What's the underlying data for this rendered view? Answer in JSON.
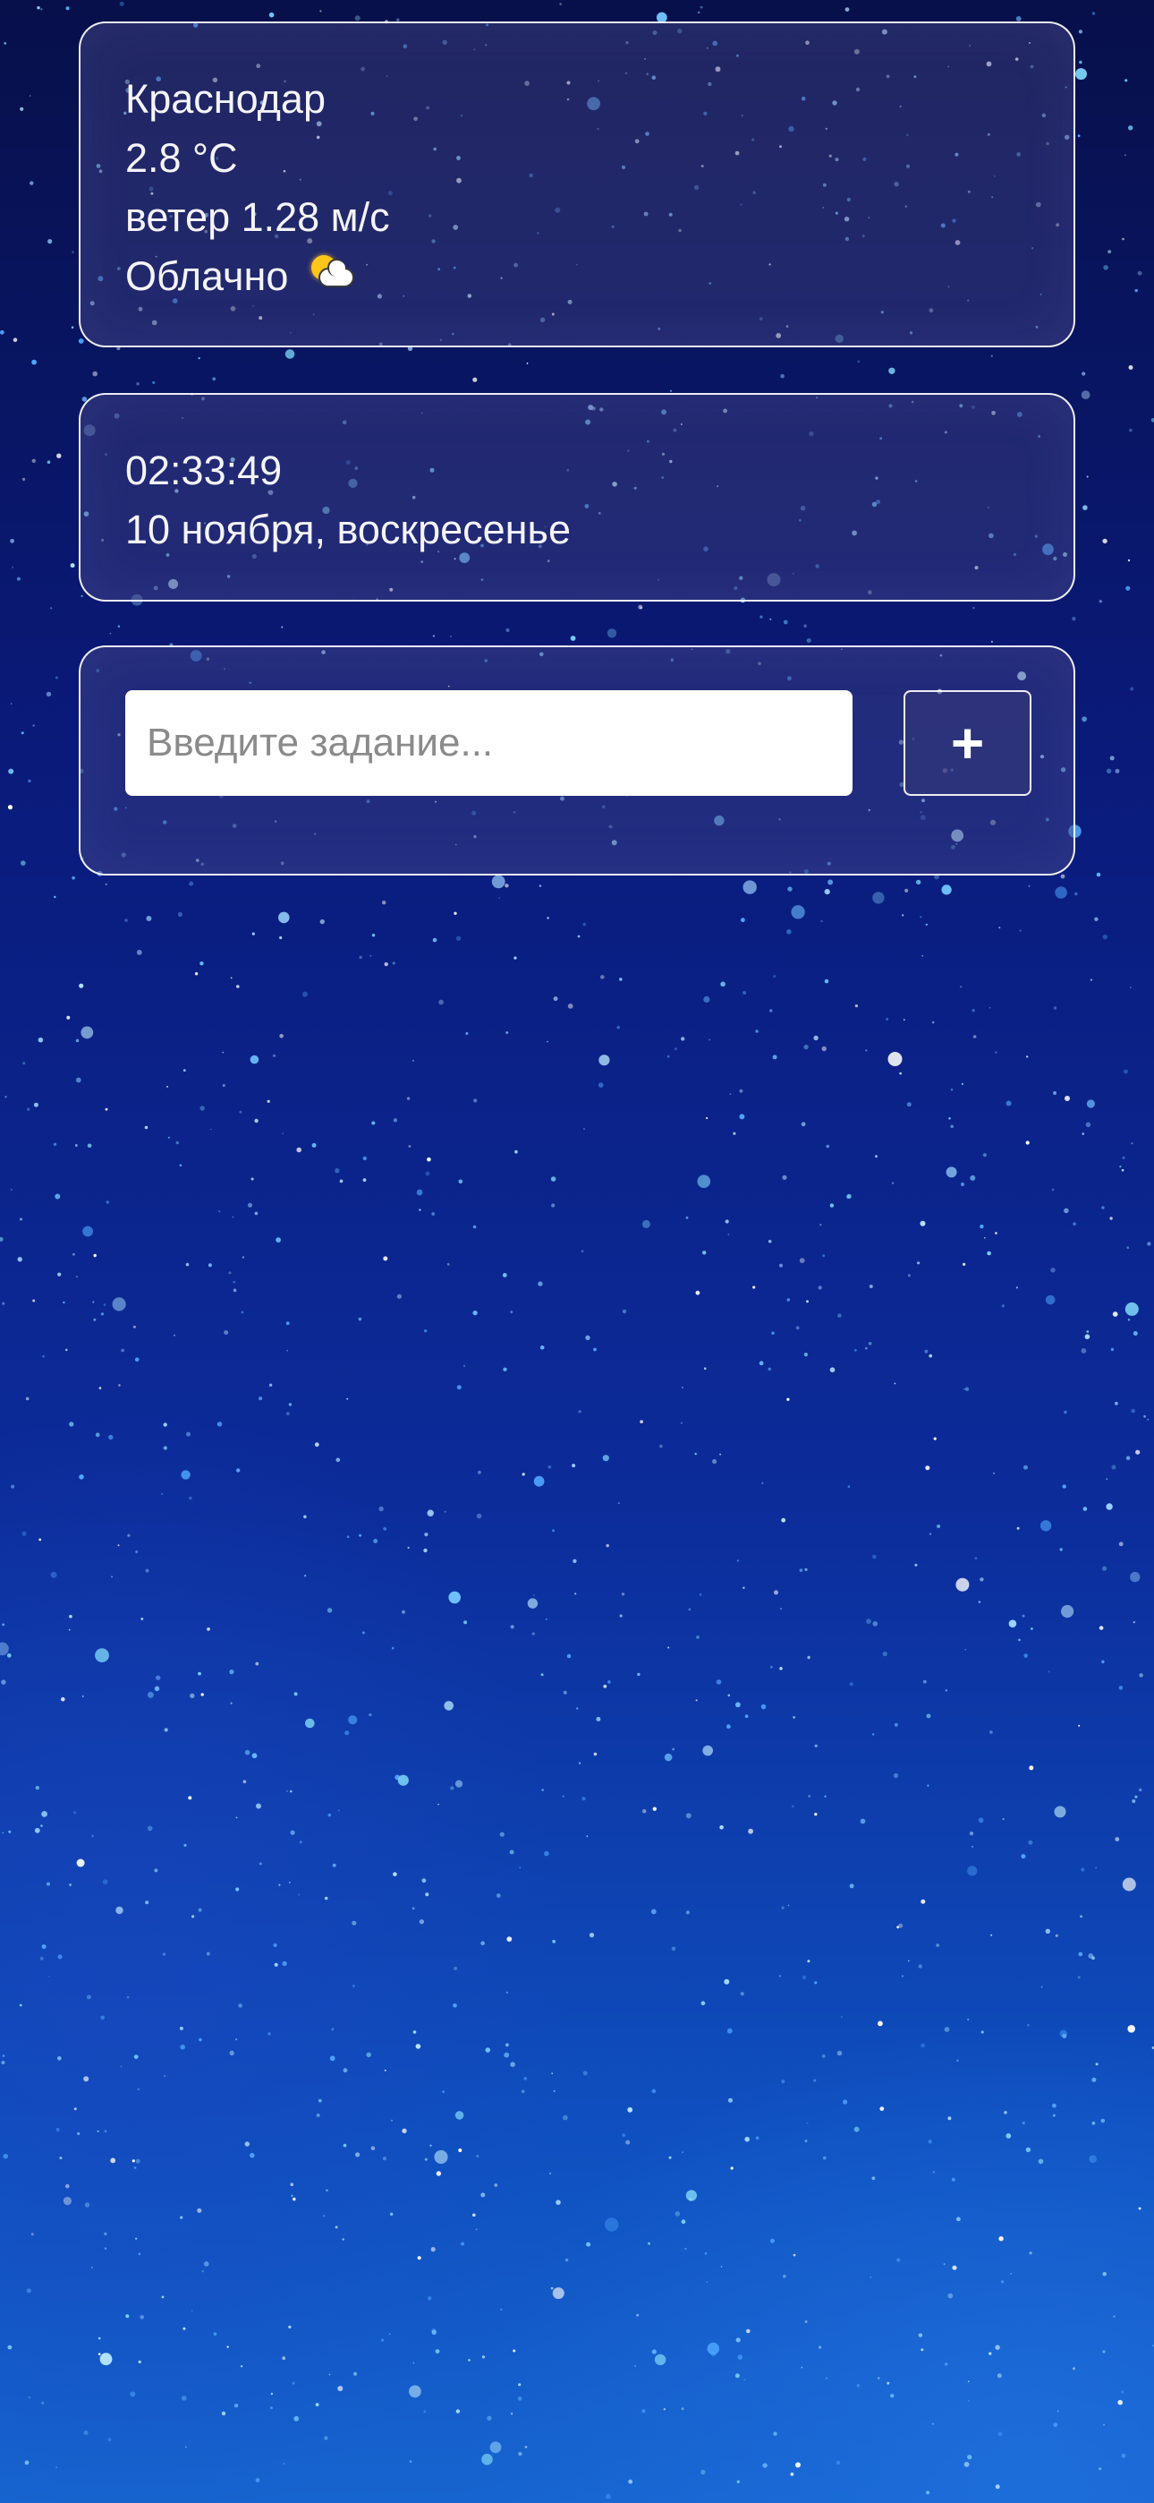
{
  "weather": {
    "city": "Краснодар",
    "temperature": "2.8 °C",
    "wind": "ветер 1.28 м/с",
    "condition": "Облачно",
    "condition_icon": "sun-behind-cloud-icon"
  },
  "clock": {
    "time": "02:33:49",
    "date": "10 ноября, воскресенье"
  },
  "todo": {
    "input_placeholder": "Введите задание...",
    "input_value": "",
    "add_button_label": "+"
  },
  "theme": {
    "background": "starry-night-blue",
    "card_border": "#ffffff",
    "card_fill": "rgba(70,70,130,0.42)"
  }
}
